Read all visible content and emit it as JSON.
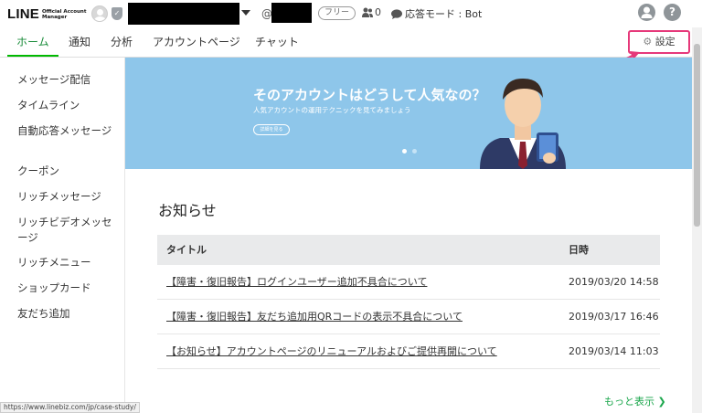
{
  "header": {
    "logo_main": "LINE",
    "logo_sub_line1": "Official Account",
    "logo_sub_line2": "Manager",
    "at_symbol": "@",
    "plan_badge": "フリー",
    "friend_count": "0",
    "response_mode": "応答モード : Bot",
    "help_label": "?"
  },
  "nav": {
    "tabs": [
      {
        "label": "ホーム",
        "active": true
      },
      {
        "label": "通知"
      },
      {
        "label": "分析"
      },
      {
        "label": "アカウントページ"
      },
      {
        "label": "チャット"
      }
    ],
    "settings_label": "設定"
  },
  "sidebar": {
    "items": [
      {
        "label": "メッセージ配信"
      },
      {
        "label": "タイムライン"
      },
      {
        "label": "自動応答メッセージ"
      },
      {
        "label": "クーポン"
      },
      {
        "label": "リッチメッセージ"
      },
      {
        "label": "リッチビデオメッセージ"
      },
      {
        "label": "リッチメニュー"
      },
      {
        "label": "ショップカード"
      },
      {
        "label": "友だち追加"
      }
    ]
  },
  "banner": {
    "title": "そのアカウントはどうして人気なの？",
    "subtitle": "人気アカウントの運用テクニックを見てみましょう",
    "button_label": "詳細を見る",
    "bg_color": "#8ec6ea"
  },
  "news": {
    "title": "お知らせ",
    "col_title": "タイトル",
    "col_date": "日時",
    "rows": [
      {
        "title": "【障害・復旧報告】ログインユーザー追加不具合について",
        "date": "2019/03/20 14:58"
      },
      {
        "title": "【障害・復旧報告】友だち追加用QRコードの表示不具合について",
        "date": "2019/03/17 16:46"
      },
      {
        "title": "【お知らせ】アカウントページのリニューアルおよびご提供再開について",
        "date": "2019/03/14 11:03"
      }
    ],
    "more_label": "もっと表示 ❯"
  },
  "status_url": "https://www.linebiz.com/jp/case-study/",
  "colors": {
    "accent": "#00b900",
    "highlight": "#e6397a"
  }
}
